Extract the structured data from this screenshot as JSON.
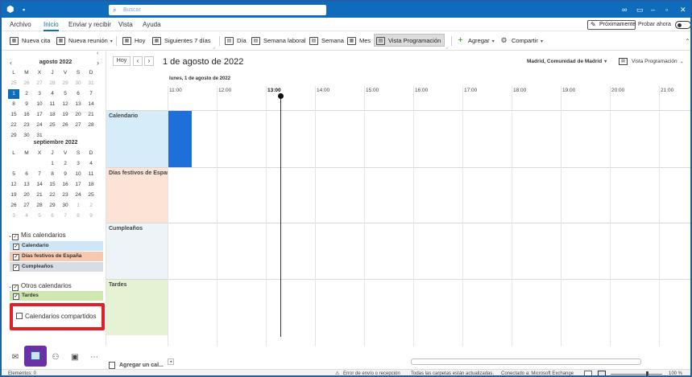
{
  "titlebar": {
    "search_placeholder": "Buscar"
  },
  "menu": {
    "items": [
      "Archivo",
      "Inicio",
      "Enviar y recibir",
      "Vista",
      "Ayuda"
    ],
    "active": "Inicio",
    "proximamente": "Próximamente",
    "try_now": "Probar ahora"
  },
  "toolbar": {
    "new_appointment": "Nueva cita",
    "new_meeting": "Nueva reunión",
    "today": "Hoy",
    "next7": "Siguientes 7 días",
    "day": "Día",
    "work_week": "Semana laboral",
    "week": "Semana",
    "month": "Mes",
    "schedule": "Vista Programación",
    "add": "Agregar",
    "share": "Compartir"
  },
  "mini_calendars": [
    {
      "title": "agosto 2022",
      "weekdays": [
        "L",
        "M",
        "X",
        "J",
        "V",
        "S",
        "D"
      ],
      "rows": [
        [
          "25",
          "26",
          "27",
          "28",
          "29",
          "30",
          "31"
        ],
        [
          "1",
          "2",
          "3",
          "4",
          "5",
          "6",
          "7"
        ],
        [
          "8",
          "9",
          "10",
          "11",
          "12",
          "13",
          "14"
        ],
        [
          "15",
          "16",
          "17",
          "18",
          "19",
          "20",
          "21"
        ],
        [
          "22",
          "23",
          "24",
          "25",
          "26",
          "27",
          "28"
        ],
        [
          "29",
          "30",
          "31",
          "",
          "",
          "",
          ""
        ]
      ]
    },
    {
      "title": "septiembre 2022",
      "weekdays": [
        "L",
        "M",
        "X",
        "J",
        "V",
        "S",
        "D"
      ],
      "rows": [
        [
          "",
          "",
          "",
          "1",
          "2",
          "3",
          "4"
        ],
        [
          "5",
          "6",
          "7",
          "8",
          "9",
          "10",
          "11"
        ],
        [
          "12",
          "13",
          "14",
          "15",
          "16",
          "17",
          "18"
        ],
        [
          "19",
          "20",
          "21",
          "22",
          "23",
          "24",
          "25"
        ],
        [
          "26",
          "27",
          "28",
          "29",
          "30",
          "1",
          "2"
        ],
        [
          "3",
          "4",
          "5",
          "6",
          "7",
          "8",
          "9"
        ]
      ]
    }
  ],
  "calendars": {
    "my_group": "Mis calendarios",
    "my_items": [
      {
        "label": "Calendario",
        "color": "#cfe6f7"
      },
      {
        "label": "Días festivos de España",
        "color": "#f6c9b0"
      },
      {
        "label": "Cumpleaños",
        "color": "#d7dde3"
      }
    ],
    "other_group": "Otros calendarios",
    "other_items": [
      {
        "label": "Tardes",
        "color": "#cfe6b0"
      }
    ],
    "shared": "Calendarios compartidos"
  },
  "main": {
    "today_btn": "Hoy",
    "date_title": "1 de agosto de 2022",
    "region": "Madrid, Comunidad de Madrid",
    "view": "Vista Programación",
    "day_header": "lunes, 1 de agosto de 2022",
    "hours": [
      "11:00",
      "12:00",
      "13:00",
      "14:00",
      "15:00",
      "16:00",
      "17:00",
      "18:00",
      "19:00",
      "20:00",
      "21:00"
    ],
    "current_hour": "13:00",
    "rows": [
      {
        "label": "Calendario",
        "color": "#d7ecf9"
      },
      {
        "label": "Días festivos de España",
        "color": "#fbe4d6"
      },
      {
        "label": "Cumpleaños",
        "color": "#eef3f7"
      },
      {
        "label": "Tardes",
        "color": "#e6f2d4"
      }
    ],
    "add_calendar": "Agregar un cal..."
  },
  "status": {
    "items": "Elementos: 0",
    "error": "Error de envío o recepción",
    "folders": "Todas las carpetas están actualizadas.",
    "connected": "Conectado a: Microsoft Exchange",
    "zoom": "100 %"
  },
  "colors": {
    "accent": "#0f6cbd",
    "highlight": "#e31e24",
    "nav_selected": "#6b2fa6"
  }
}
